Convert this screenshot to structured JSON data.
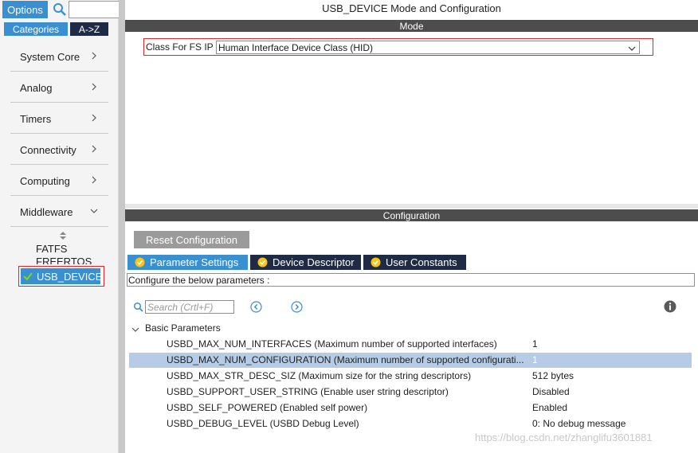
{
  "sidebar": {
    "options_label": "Options",
    "search_value": "",
    "tabs": {
      "categories": "Categories",
      "az": "A->Z"
    },
    "categories": [
      {
        "label": "System Core"
      },
      {
        "label": "Analog"
      },
      {
        "label": "Timers"
      },
      {
        "label": "Connectivity"
      },
      {
        "label": "Computing"
      },
      {
        "label": "Middleware"
      }
    ],
    "middleware_items": [
      {
        "label": "FATFS"
      },
      {
        "label": "FREERTOS"
      },
      {
        "label": "USB_DEVICE"
      }
    ]
  },
  "main": {
    "title": "USB_DEVICE Mode and Configuration",
    "mode_header": "Mode",
    "class_label": "Class For FS IP",
    "class_value": "Human Interface Device Class (HID)",
    "config_header": "Configuration",
    "reset_label": "Reset Configuration",
    "tabs": [
      {
        "label": "Parameter Settings"
      },
      {
        "label": "Device Descriptor"
      },
      {
        "label": "User Constants"
      }
    ],
    "config_desc": "Configure the below parameters :",
    "search_placeholder": "Search (Crtl+F)",
    "group_label": "Basic Parameters",
    "params": [
      {
        "name": "USBD_MAX_NUM_INTERFACES (Maximum number of supported interfaces)",
        "value": "1"
      },
      {
        "name": "USBD_MAX_NUM_CONFIGURATION (Maximum number of supported configurati...",
        "value": "1"
      },
      {
        "name": "USBD_MAX_STR_DESC_SIZ (Maximum size for the string descriptors)",
        "value": "512 bytes"
      },
      {
        "name": "USBD_SUPPORT_USER_STRING (Enable user string descriptor)",
        "value": "Disabled"
      },
      {
        "name": "USBD_SELF_POWERED (Enabled self power)",
        "value": "Enabled"
      },
      {
        "name": "USBD_DEBUG_LEVEL (USBD Debug Level)",
        "value": "0: No debug message"
      }
    ],
    "watermark": "https://blog.csdn.net/zhanglifu3601881"
  },
  "colors": {
    "accent_blue": "#3a8fd0",
    "dark_navy": "#1f2a44",
    "header_gray": "#4d4d4d",
    "highlight_red": "#e0262b",
    "selected_row": "#b6cce6"
  },
  "icons": {
    "search": "search-icon",
    "chevron_right": "chevron-right-icon",
    "chevron_down": "chevron-down-icon",
    "check": "check-icon",
    "info": "info-icon",
    "nav_prev": "circle-left-icon",
    "nav_next": "circle-right-icon"
  }
}
